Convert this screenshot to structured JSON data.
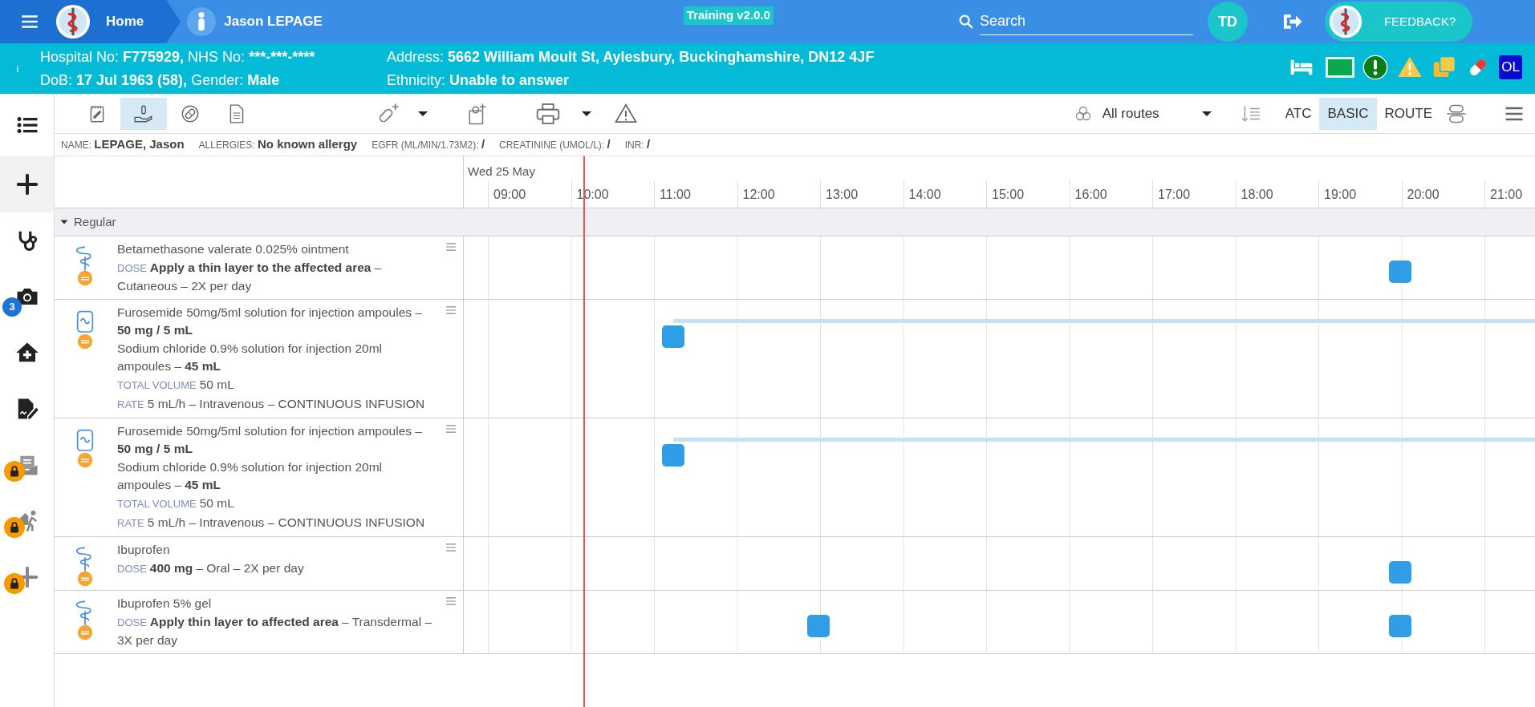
{
  "header": {
    "home": "Home",
    "patient": "Jason LEPAGE",
    "version": "Training v2.0.0",
    "search": {
      "placeholder": "Search"
    },
    "user_initials": "TD",
    "feedback": "FEEDBACK?"
  },
  "patient_banner": {
    "left": [
      [
        {
          "label": "Hospital No:",
          "value": "F775929,"
        },
        {
          "label": "NHS No:",
          "value": "***-***-****"
        }
      ],
      [
        {
          "label": "DoB:",
          "value": "17 Jul 1963 (58),"
        },
        {
          "label": "Gender:",
          "value": "Male"
        }
      ]
    ],
    "right": [
      [
        {
          "label": "Address:",
          "value": "5662 William Moult St, Aylesbury, Buckinghamshire, DN12 4JF"
        }
      ],
      [
        {
          "label": "Ethnicity:",
          "value": "Unable to answer"
        }
      ]
    ],
    "badge": "OL"
  },
  "sidebar": [
    {
      "kind": "list",
      "selected": false,
      "locked": false
    },
    {
      "kind": "plus",
      "selected": true,
      "locked": false
    },
    {
      "kind": "stethoscope",
      "selected": false,
      "locked": false
    },
    {
      "kind": "camera",
      "selected": false,
      "locked": false,
      "badge": "3"
    },
    {
      "kind": "house",
      "selected": false,
      "locked": false
    },
    {
      "kind": "document",
      "selected": false,
      "locked": false
    },
    {
      "kind": "letter",
      "selected": false,
      "locked": true
    },
    {
      "kind": "walker",
      "selected": false,
      "locked": true
    },
    {
      "kind": "plus",
      "selected": false,
      "locked": true
    }
  ],
  "toolbar": {
    "tools": [
      {
        "kind": "chart",
        "selected": false
      },
      {
        "kind": "administer",
        "selected": true
      },
      {
        "kind": "pill",
        "selected": false
      },
      {
        "kind": "document",
        "selected": false
      }
    ],
    "routes": "All routes",
    "views": [
      {
        "label": "ATC",
        "selected": false
      },
      {
        "label": "BASIC",
        "selected": true
      },
      {
        "label": "ROUTE",
        "selected": false
      }
    ]
  },
  "info": [
    {
      "label": "NAME:",
      "value": "LEPAGE, Jason"
    },
    {
      "label": "ALLERGIES:",
      "value": "No known allergy"
    },
    {
      "label": "EGFR (ML/MIN/1.73M2):",
      "value": "/"
    },
    {
      "label": "CREATININE (UMOL/L):",
      "value": "/"
    },
    {
      "label": "INR:",
      "value": "/"
    }
  ],
  "timeline": {
    "date": "Wed 25 May",
    "hours": [
      "09:00",
      "10:00",
      "11:00",
      "12:00",
      "13:00",
      "14:00",
      "15:00",
      "16:00",
      "17:00",
      "18:00",
      "19:00",
      "20:00",
      "21:00"
    ]
  },
  "group": {
    "label": "Regular",
    "expanded": true
  },
  "medications": [
    {
      "kind": "topical",
      "lines": [
        {
          "text": "Betamethasone valerate 0.025% ointment"
        },
        {
          "label": "DOSE",
          "value": "Apply a thin layer to the affected area",
          "rest": "– Cutaneous – 2X per day"
        }
      ],
      "events": [
        {
          "kind": "dose"
        }
      ]
    },
    {
      "kind": "infusion",
      "lines": [
        {
          "text": "Furosemide 50mg/5ml solution for injection ampoules –",
          "value": "50 mg / 5 mL"
        },
        {
          "text": "Sodium chloride 0.9% solution for injection 20ml ampoules –",
          "value": "45 mL"
        },
        {
          "label": "TOTAL VOLUME",
          "rest": "50 mL"
        },
        {
          "label": "RATE",
          "rest": "5 mL/h – Intravenous – CONTINUOUS INFUSION"
        }
      ],
      "events": [
        {
          "kind": "infusion"
        }
      ]
    },
    {
      "kind": "infusion",
      "lines": [
        {
          "text": "Furosemide 50mg/5ml solution for injection ampoules –",
          "value": "50 mg / 5 mL"
        },
        {
          "text": "Sodium chloride 0.9% solution for injection 20ml ampoules –",
          "value": "45 mL"
        },
        {
          "label": "TOTAL VOLUME",
          "rest": "50 mL"
        },
        {
          "label": "RATE",
          "rest": "5 mL/h – Intravenous – CONTINUOUS INFUSION"
        }
      ],
      "events": [
        {
          "kind": "infusion"
        }
      ]
    },
    {
      "kind": "topical",
      "lines": [
        {
          "text": "Ibuprofen"
        },
        {
          "label": "DOSE",
          "value": "400 mg",
          "rest": "– Oral – 2X per day"
        }
      ],
      "events": [
        {
          "kind": "dose"
        }
      ]
    },
    {
      "kind": "topical",
      "lines": [
        {
          "text": "Ibuprofen 5% gel"
        },
        {
          "label": "DOSE",
          "value": "Apply thin layer to affected area",
          "rest": "– Transdermal – 3X per day"
        }
      ],
      "events": [
        {
          "kind": "dose"
        },
        {
          "kind": "dose"
        }
      ]
    }
  ]
}
